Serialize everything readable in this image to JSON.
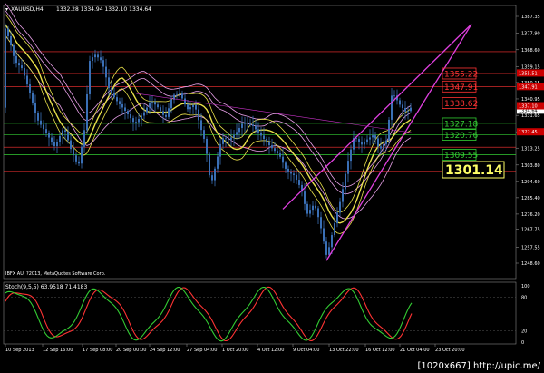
{
  "header": {
    "symbol_label": "XAUUSD,H4",
    "ohlc": "1332.28 1334.94 1332.10 1334.64"
  },
  "indicator": {
    "label": "Stoch(9,5,5) 63.9518 71.4183",
    "scale_labels": [
      "100",
      "80",
      "20",
      "0"
    ]
  },
  "footer_note": "IBFX AU, ?2013, MetaQuotes Software Corp.",
  "price_axis": [
    "1387.35",
    "1377.90",
    "1368.60",
    "1359.15",
    "1350.15",
    "1340.95",
    "1331.65",
    "1322.45",
    "1313.25",
    "1303.80",
    "1294.60",
    "1285.40",
    "1276.20",
    "1267.75",
    "1257.55",
    "1248.60"
  ],
  "current_price_label": "1334.64",
  "right_tags": [
    "1355.51",
    "1347.91",
    "1337.10",
    "1322.45"
  ],
  "time_axis": [
    "10 Sep 2013",
    "12 Sep 16:00",
    "17 Sep 08:00",
    "20 Sep 00:00",
    "24 Sep 12:00",
    "27 Sep 04:00",
    "1 Oct 20:00",
    "4 Oct 12:00",
    "9 Oct 04:00",
    "13 Oct 22:00",
    "16 Oct 12:00",
    "21 Oct 04:00",
    "23 Oct 20:00"
  ],
  "levels": [
    {
      "label": "1355.22",
      "color": "#ff3333"
    },
    {
      "label": "1347.91",
      "color": "#ff3333"
    },
    {
      "label": "1338.62",
      "color": "#ff3333"
    },
    {
      "label": "1327.18",
      "color": "#33cc33"
    },
    {
      "label": "1320.76",
      "color": "#33cc33"
    },
    {
      "label": "1309.55",
      "color": "#33cc33"
    }
  ],
  "highlight_level": "1301.14",
  "watermark": "[1020x667] http://upic.me/",
  "colors": {
    "background": "#000000",
    "candle": "#3a6fb5",
    "channel": "#cc33cc",
    "wedge": "#e040e0",
    "resistance": "#ff3333",
    "support": "#33cc33",
    "ma_yellow": "#e8e04a",
    "ma_pink": "#e8a0e8",
    "stoch_main": "#33cc33",
    "stoch_signal": "#ff3333"
  }
}
